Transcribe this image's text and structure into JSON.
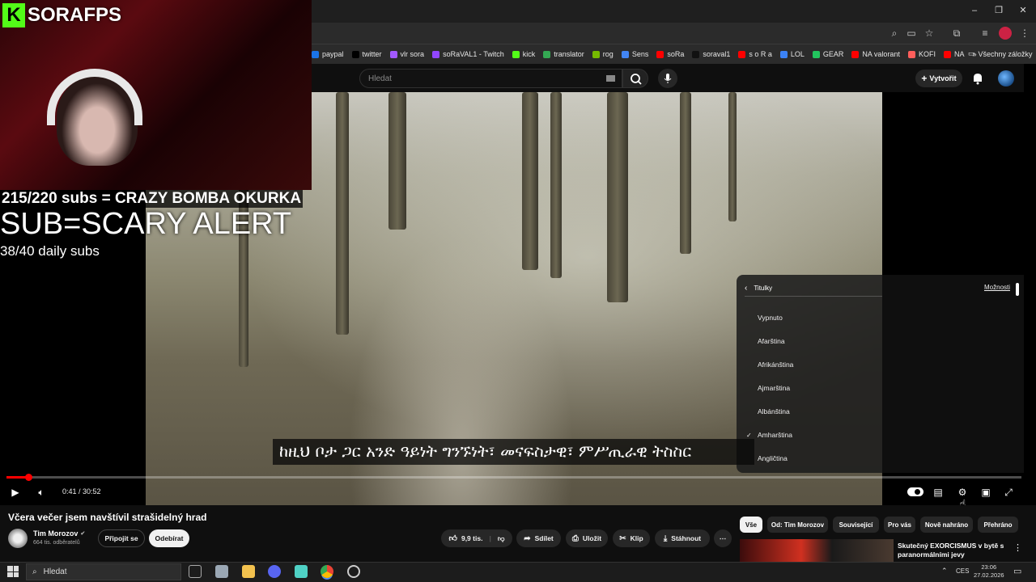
{
  "browser": {
    "bookmarks": [
      "paypal",
      "twitter",
      "vlr sora",
      "soRaVAL1 - Twitch",
      "kick",
      "translator",
      "rog",
      "Sens",
      "soRa",
      "soraval1",
      "s o R a",
      "LOL",
      "GEAR",
      "NA valorant",
      "KOFI",
      "NA"
    ],
    "bookmark_colors": [
      "#1a73e8",
      "#000000",
      "#a259ff",
      "#9146ff",
      "#53fc18",
      "#34a853",
      "#76b900",
      "#4285f4",
      "#ff0000",
      "#111111",
      "#ff0000",
      "#3b82f6",
      "#22c55e",
      "#ff0000",
      "#ff5e5b",
      "#ff0000"
    ],
    "more_label": "»",
    "all_bookmarks": "Všechny záložky"
  },
  "youtube": {
    "search_placeholder": "Hledat",
    "create_label": "Vytvořit"
  },
  "player": {
    "time": "0:41 / 30:52",
    "progress_fraction": 0.022,
    "caption": "ከዚህ ቦታ ጋር አንድ ዓይነት ግንኙነት፣ መናፍስታዊ፣ ምሥጢራዊ ትስስር",
    "subtitle_menu": {
      "title": "Titulky",
      "options_link": "Možnosti",
      "items": [
        "Vypnuto",
        "Afarština",
        "Afrikánština",
        "Ajmarština",
        "Albánština",
        "Amharština",
        "Angličtina"
      ],
      "checked_index": 5
    }
  },
  "video_info": {
    "title": "Včera večer jsem navštívil strašidelný hrad",
    "channel": "Tim Morozov",
    "subscribers": "664 tis. odběratelů",
    "join_label": "Připojit se",
    "subscribe_label": "Odebírat",
    "likes": "9,9 tis.",
    "share_label": "Sdílet",
    "save_label": "Uložit",
    "clip_label": "Klip",
    "download_label": "Stáhnout"
  },
  "chips": [
    "Vše",
    "Od: Tim Morozov",
    "Související",
    "Pro vás",
    "Nově nahráno",
    "Přehráno"
  ],
  "recommendation": {
    "title": "Skutečný EXORCISMUS v bytě s paranormálními jevy"
  },
  "stream_overlay": {
    "logo_letter": "K",
    "logo_name": "SORAFPS",
    "line1": "215/220 subs = CRAZY BOMBA OKURKA",
    "line2": "SUB=SCARY ALERT",
    "line3": "38/40 daily subs"
  },
  "taskbar": {
    "search": "Hledat",
    "lang": "CES",
    "time": "23:06",
    "date": "27.02.2026"
  }
}
